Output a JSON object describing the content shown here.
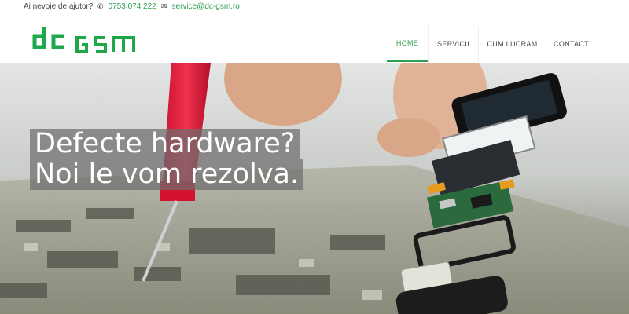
{
  "topbar": {
    "help_text": "Ai nevoie de ajutor?",
    "phone": "0753 074 222",
    "email": "service@dc-gsm.ro"
  },
  "logo": {
    "text_left": "dc",
    "text_right": "GSM"
  },
  "nav": {
    "items": [
      {
        "label": "HOME",
        "active": true
      },
      {
        "label": "SERVICII",
        "active": false
      },
      {
        "label": "CUM LUCRAM",
        "active": false
      },
      {
        "label": "CONTACT",
        "active": false
      }
    ]
  },
  "hero": {
    "line1": "Defecte hardware?",
    "line2": "Noi le vom rezolva."
  },
  "colors": {
    "accent": "#2e9e4f",
    "logo_green": "#1fa84a"
  },
  "icons": {
    "phone": "phone-icon",
    "email": "envelope-icon"
  }
}
